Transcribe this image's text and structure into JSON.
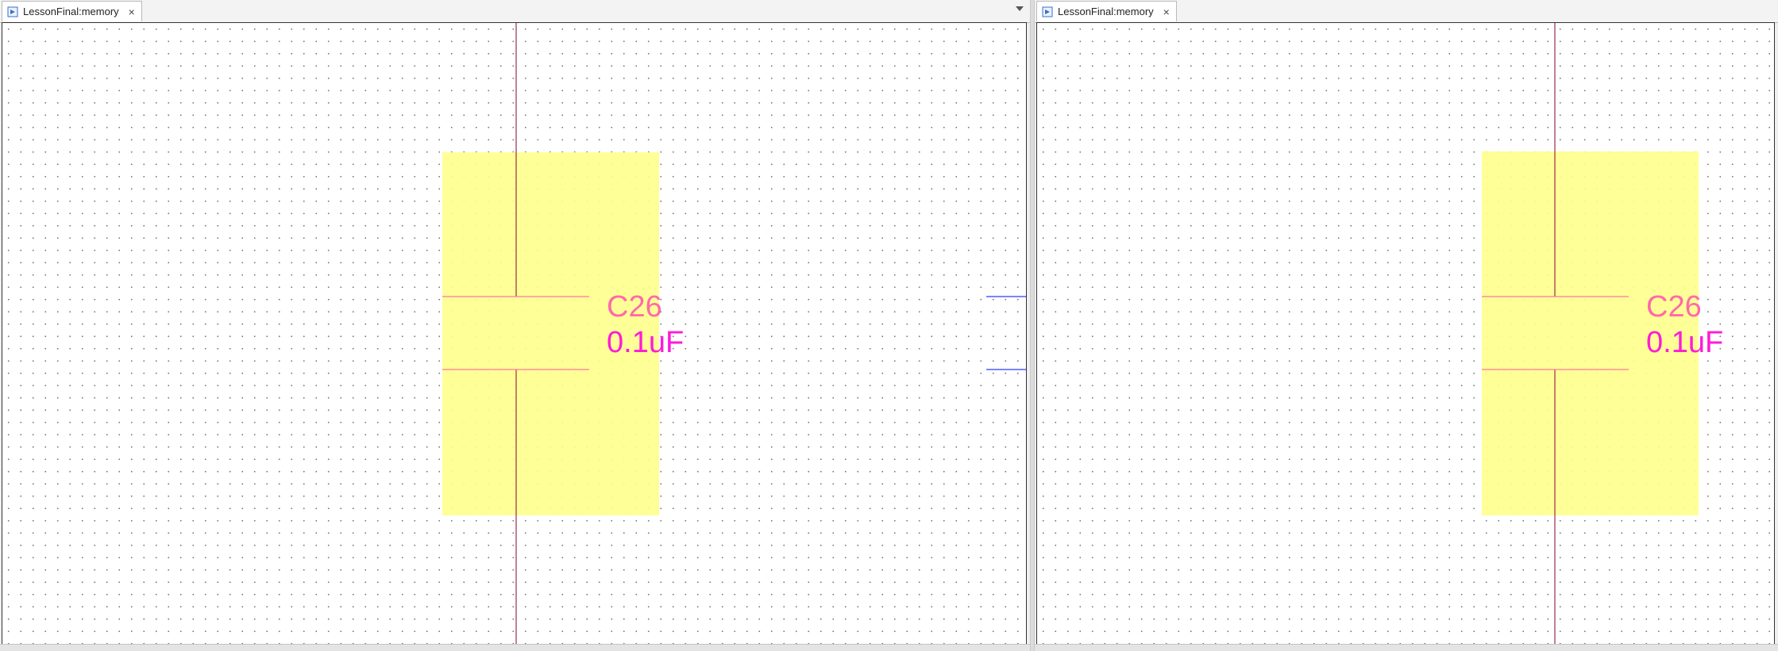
{
  "left_tab": {
    "title": "LessonFinal:memory",
    "close_glyph": "×"
  },
  "right_tab": {
    "title": "LessonFinal:memory",
    "close_glyph": "×"
  },
  "component": {
    "designator": "C26",
    "value": "0.1uF"
  },
  "colors": {
    "selection_fill": "#ffff8c",
    "wire_vertical": "#9a2d4a",
    "plate": "#ff78a0",
    "designator_text": "#ff6aa8",
    "value_text": "#ff1ad8",
    "net_line": "#2a3cff"
  },
  "icons": {
    "tab_icon": "schematic-document-icon",
    "close": "close-icon",
    "menu": "chevron-down-icon"
  }
}
